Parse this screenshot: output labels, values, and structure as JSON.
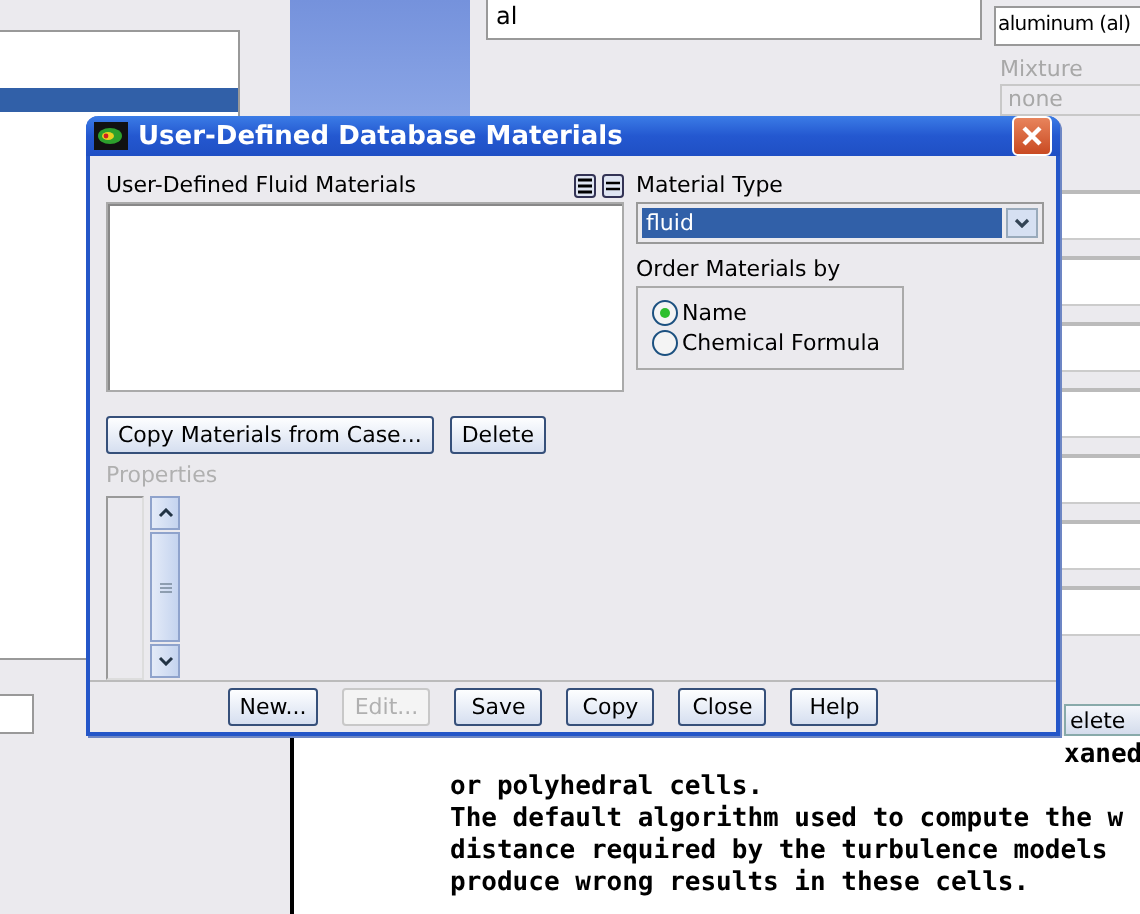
{
  "background": {
    "list_rows": [
      {
        "selected": true
      }
    ],
    "name_field": {
      "value": "al"
    },
    "material_dropdown": {
      "value": "aluminum (al)"
    },
    "mixture": {
      "label": "Mixture",
      "value": "none",
      "disabled": true
    },
    "side_button": {
      "label": "elete"
    },
    "console_lines": [
      "xaned",
      "or polyhedral cells.",
      "The default algorithm used to compute the w",
      "distance required by the turbulence models",
      "produce wrong results in these cells."
    ]
  },
  "dialog": {
    "title": "User-Defined Database Materials",
    "list_label": "User-Defined Fluid Materials",
    "material_type": {
      "label": "Material Type",
      "value": "fluid"
    },
    "order": {
      "label": "Order Materials by",
      "options": [
        {
          "label": "Name",
          "selected": true
        },
        {
          "label": "Chemical Formula",
          "selected": false
        }
      ]
    },
    "action_buttons": [
      {
        "label": "Copy Materials from Case...",
        "disabled": false
      },
      {
        "label": "Delete",
        "disabled": false
      }
    ],
    "properties": {
      "label": "Properties",
      "disabled": true
    },
    "footer_buttons": [
      {
        "label": "New...",
        "disabled": false
      },
      {
        "label": "Edit...",
        "disabled": true
      },
      {
        "label": "Save",
        "disabled": false
      },
      {
        "label": "Copy",
        "disabled": false
      },
      {
        "label": "Close",
        "disabled": false
      },
      {
        "label": "Help",
        "disabled": false
      }
    ]
  }
}
